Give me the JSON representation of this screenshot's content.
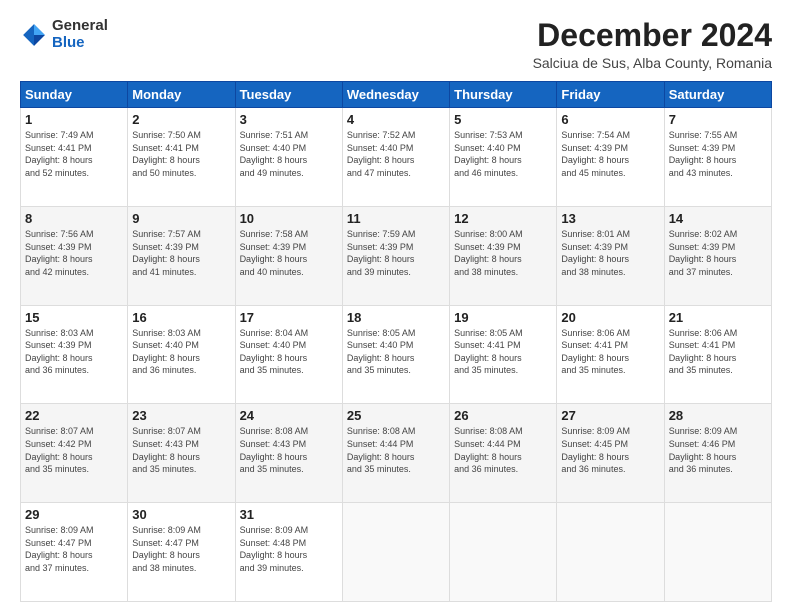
{
  "header": {
    "logo_general": "General",
    "logo_blue": "Blue",
    "month_title": "December 2024",
    "location": "Salciua de Sus, Alba County, Romania"
  },
  "days_of_week": [
    "Sunday",
    "Monday",
    "Tuesday",
    "Wednesday",
    "Thursday",
    "Friday",
    "Saturday"
  ],
  "weeks": [
    [
      {
        "day": 1,
        "info": "Sunrise: 7:49 AM\nSunset: 4:41 PM\nDaylight: 8 hours\nand 52 minutes."
      },
      {
        "day": 2,
        "info": "Sunrise: 7:50 AM\nSunset: 4:41 PM\nDaylight: 8 hours\nand 50 minutes."
      },
      {
        "day": 3,
        "info": "Sunrise: 7:51 AM\nSunset: 4:40 PM\nDaylight: 8 hours\nand 49 minutes."
      },
      {
        "day": 4,
        "info": "Sunrise: 7:52 AM\nSunset: 4:40 PM\nDaylight: 8 hours\nand 47 minutes."
      },
      {
        "day": 5,
        "info": "Sunrise: 7:53 AM\nSunset: 4:40 PM\nDaylight: 8 hours\nand 46 minutes."
      },
      {
        "day": 6,
        "info": "Sunrise: 7:54 AM\nSunset: 4:39 PM\nDaylight: 8 hours\nand 45 minutes."
      },
      {
        "day": 7,
        "info": "Sunrise: 7:55 AM\nSunset: 4:39 PM\nDaylight: 8 hours\nand 43 minutes."
      }
    ],
    [
      {
        "day": 8,
        "info": "Sunrise: 7:56 AM\nSunset: 4:39 PM\nDaylight: 8 hours\nand 42 minutes."
      },
      {
        "day": 9,
        "info": "Sunrise: 7:57 AM\nSunset: 4:39 PM\nDaylight: 8 hours\nand 41 minutes."
      },
      {
        "day": 10,
        "info": "Sunrise: 7:58 AM\nSunset: 4:39 PM\nDaylight: 8 hours\nand 40 minutes."
      },
      {
        "day": 11,
        "info": "Sunrise: 7:59 AM\nSunset: 4:39 PM\nDaylight: 8 hours\nand 39 minutes."
      },
      {
        "day": 12,
        "info": "Sunrise: 8:00 AM\nSunset: 4:39 PM\nDaylight: 8 hours\nand 38 minutes."
      },
      {
        "day": 13,
        "info": "Sunrise: 8:01 AM\nSunset: 4:39 PM\nDaylight: 8 hours\nand 38 minutes."
      },
      {
        "day": 14,
        "info": "Sunrise: 8:02 AM\nSunset: 4:39 PM\nDaylight: 8 hours\nand 37 minutes."
      }
    ],
    [
      {
        "day": 15,
        "info": "Sunrise: 8:03 AM\nSunset: 4:39 PM\nDaylight: 8 hours\nand 36 minutes."
      },
      {
        "day": 16,
        "info": "Sunrise: 8:03 AM\nSunset: 4:40 PM\nDaylight: 8 hours\nand 36 minutes."
      },
      {
        "day": 17,
        "info": "Sunrise: 8:04 AM\nSunset: 4:40 PM\nDaylight: 8 hours\nand 35 minutes."
      },
      {
        "day": 18,
        "info": "Sunrise: 8:05 AM\nSunset: 4:40 PM\nDaylight: 8 hours\nand 35 minutes."
      },
      {
        "day": 19,
        "info": "Sunrise: 8:05 AM\nSunset: 4:41 PM\nDaylight: 8 hours\nand 35 minutes."
      },
      {
        "day": 20,
        "info": "Sunrise: 8:06 AM\nSunset: 4:41 PM\nDaylight: 8 hours\nand 35 minutes."
      },
      {
        "day": 21,
        "info": "Sunrise: 8:06 AM\nSunset: 4:41 PM\nDaylight: 8 hours\nand 35 minutes."
      }
    ],
    [
      {
        "day": 22,
        "info": "Sunrise: 8:07 AM\nSunset: 4:42 PM\nDaylight: 8 hours\nand 35 minutes."
      },
      {
        "day": 23,
        "info": "Sunrise: 8:07 AM\nSunset: 4:43 PM\nDaylight: 8 hours\nand 35 minutes."
      },
      {
        "day": 24,
        "info": "Sunrise: 8:08 AM\nSunset: 4:43 PM\nDaylight: 8 hours\nand 35 minutes."
      },
      {
        "day": 25,
        "info": "Sunrise: 8:08 AM\nSunset: 4:44 PM\nDaylight: 8 hours\nand 35 minutes."
      },
      {
        "day": 26,
        "info": "Sunrise: 8:08 AM\nSunset: 4:44 PM\nDaylight: 8 hours\nand 36 minutes."
      },
      {
        "day": 27,
        "info": "Sunrise: 8:09 AM\nSunset: 4:45 PM\nDaylight: 8 hours\nand 36 minutes."
      },
      {
        "day": 28,
        "info": "Sunrise: 8:09 AM\nSunset: 4:46 PM\nDaylight: 8 hours\nand 36 minutes."
      }
    ],
    [
      {
        "day": 29,
        "info": "Sunrise: 8:09 AM\nSunset: 4:47 PM\nDaylight: 8 hours\nand 37 minutes."
      },
      {
        "day": 30,
        "info": "Sunrise: 8:09 AM\nSunset: 4:47 PM\nDaylight: 8 hours\nand 38 minutes."
      },
      {
        "day": 31,
        "info": "Sunrise: 8:09 AM\nSunset: 4:48 PM\nDaylight: 8 hours\nand 39 minutes."
      },
      null,
      null,
      null,
      null
    ]
  ]
}
